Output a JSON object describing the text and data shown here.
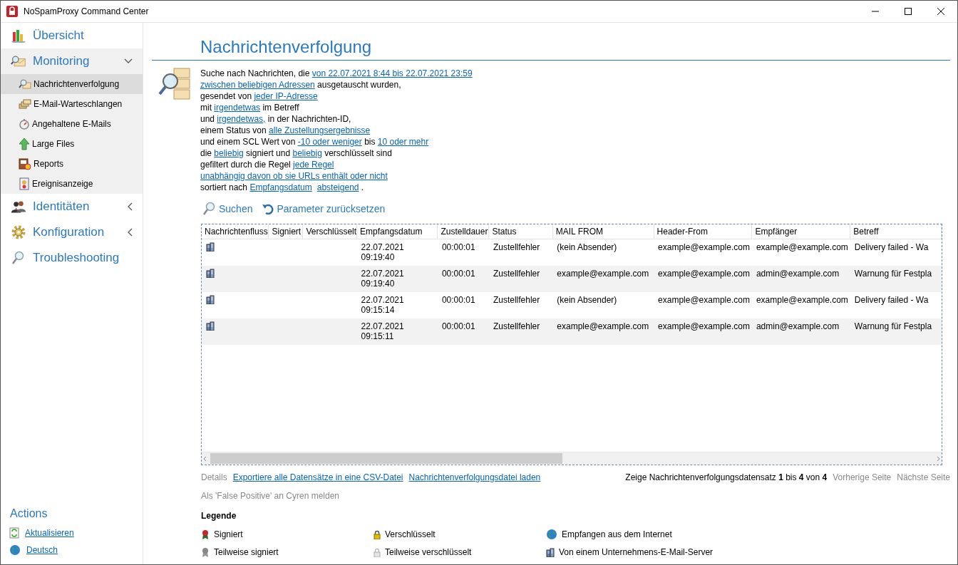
{
  "window": {
    "title": "NoSpamProxy Command Center"
  },
  "sidebar": {
    "items": [
      {
        "label": "Übersicht",
        "kind": "leaf"
      },
      {
        "label": "Monitoring",
        "kind": "group",
        "expanded": true,
        "children": [
          {
            "label": "Nachrichtenverfolgung",
            "selected": true
          },
          {
            "label": "E-Mail-Warteschlangen",
            "selected": false
          },
          {
            "label": "Angehaltene E-Mails",
            "selected": false
          },
          {
            "label": "Large Files",
            "selected": false
          },
          {
            "label": "Reports",
            "selected": false
          },
          {
            "label": "Ereignisanzeige",
            "selected": false
          }
        ]
      },
      {
        "label": "Identitäten",
        "kind": "group",
        "expanded": false
      },
      {
        "label": "Konfiguration",
        "kind": "group",
        "expanded": false
      },
      {
        "label": "Troubleshooting",
        "kind": "leaf"
      }
    ],
    "actions_title": "Actions",
    "actions": [
      {
        "label": "Aktualisieren"
      },
      {
        "label": "Deutsch"
      }
    ]
  },
  "page": {
    "title": "Nachrichtenverfolgung",
    "query": [
      [
        {
          "kind": "text",
          "text": "Suche nach Nachrichten, die "
        },
        {
          "kind": "link",
          "text": "von 22.07.2021 8:44 bis 22.07.2021 23:59"
        }
      ],
      [
        {
          "kind": "link",
          "text": "zwischen beliebigen Adressen"
        },
        {
          "kind": "text",
          "text": " ausgetauscht wurden,"
        }
      ],
      [
        {
          "kind": "text",
          "text": "gesendet von "
        },
        {
          "kind": "link",
          "text": "jeder IP-Adresse"
        }
      ],
      [
        {
          "kind": "text",
          "text": "mit "
        },
        {
          "kind": "link",
          "text": "irgendetwas"
        },
        {
          "kind": "text",
          "text": " im Betreff"
        }
      ],
      [
        {
          "kind": "text",
          "text": "und "
        },
        {
          "kind": "link",
          "text": "irgendetwas,"
        },
        {
          "kind": "text",
          "text": " in der Nachrichten-ID,"
        }
      ],
      [
        {
          "kind": "text",
          "text": "einem Status von "
        },
        {
          "kind": "link",
          "text": "alle Zustellungsergebnisse"
        }
      ],
      [
        {
          "kind": "text",
          "text": "und einem SCL Wert von "
        },
        {
          "kind": "link",
          "text": "-10 oder weniger"
        },
        {
          "kind": "text",
          "text": " bis "
        },
        {
          "kind": "link",
          "text": "10 oder mehr"
        }
      ],
      [
        {
          "kind": "text",
          "text": "die "
        },
        {
          "kind": "link",
          "text": "beliebig"
        },
        {
          "kind": "text",
          "text": " signiert und "
        },
        {
          "kind": "link",
          "text": "beliebig"
        },
        {
          "kind": "text",
          "text": " verschlüsselt sind"
        }
      ],
      [
        {
          "kind": "text",
          "text": "gefiltert durch die Regel "
        },
        {
          "kind": "link",
          "text": "jede Regel"
        }
      ],
      [
        {
          "kind": "link",
          "text": "unabhängig davon ob sie URLs enthält oder nicht"
        }
      ],
      [
        {
          "kind": "text",
          "text": "sortiert nach "
        },
        {
          "kind": "link",
          "text": "Empfangsdatum"
        },
        {
          "kind": "link",
          "text": "absteigend"
        },
        {
          "kind": "text",
          "text": " ."
        }
      ]
    ],
    "buttons": [
      {
        "label": "Suchen"
      },
      {
        "label": "Parameter zurücksetzen"
      }
    ],
    "table": {
      "columns": [
        "Nachrichtenfluss",
        "Signiert",
        "Verschlüsselt",
        "Empfangsdatum",
        "Zustelldauer",
        "Status",
        "MAIL FROM",
        "Header-From",
        "Empfänger",
        "Betreff"
      ],
      "rows": [
        {
          "cells": [
            "",
            "",
            "",
            "22.07.2021\n09:19:40",
            "00:00:01",
            "Zustellfehler",
            "(kein Absender)",
            "example@example.com",
            "example@example.com",
            "Delivery failed - Wa"
          ]
        },
        {
          "cells": [
            "",
            "",
            "",
            "22.07.2021\n09:19:40",
            "00:00:01",
            "Zustellfehler",
            "example@example.com",
            "example@example.com",
            "admin@example.com",
            "Warnung für Festpla"
          ]
        },
        {
          "cells": [
            "",
            "",
            "",
            "22.07.2021\n09:15:14",
            "00:00:01",
            "Zustellfehler",
            "(kein Absender)",
            "example@example.com",
            "example@example.com",
            "Delivery failed - Wa"
          ]
        },
        {
          "cells": [
            "",
            "",
            "",
            "22.07.2021\n09:15:11",
            "00:00:01",
            "Zustellfehler",
            "example@example.com",
            "example@example.com",
            "admin@example.com",
            "Warnung für Festpla"
          ]
        }
      ]
    },
    "footer_links": [
      {
        "label": "Details",
        "disabled": true
      },
      {
        "label": "Exportiere alle Datensätze in eine CSV-Datei",
        "disabled": false
      },
      {
        "label": "Nachrichtenverfolgungsdatei laden",
        "disabled": false
      }
    ],
    "pager": {
      "summary": "Zeige Nachrichtenverfolgungsdatensatz **1** bis **4** von **4**",
      "links": [
        {
          "label": "Vorherige Seite",
          "disabled": true
        },
        {
          "label": "Nächste Seite",
          "disabled": true
        }
      ]
    },
    "report_link": {
      "label": "Als 'False Positive' an Cyren melden",
      "disabled": true
    },
    "legend": {
      "title": "Legende",
      "items": [
        {
          "label": "Signiert"
        },
        {
          "label": "Verschlüsselt"
        },
        {
          "label": "Empfangen aus dem Internet"
        },
        {
          "label": "Teilweise signiert"
        },
        {
          "label": "Teilweise verschlüsselt"
        },
        {
          "label": "Von einem Unternehmens-E-Mail-Server"
        }
      ]
    }
  }
}
